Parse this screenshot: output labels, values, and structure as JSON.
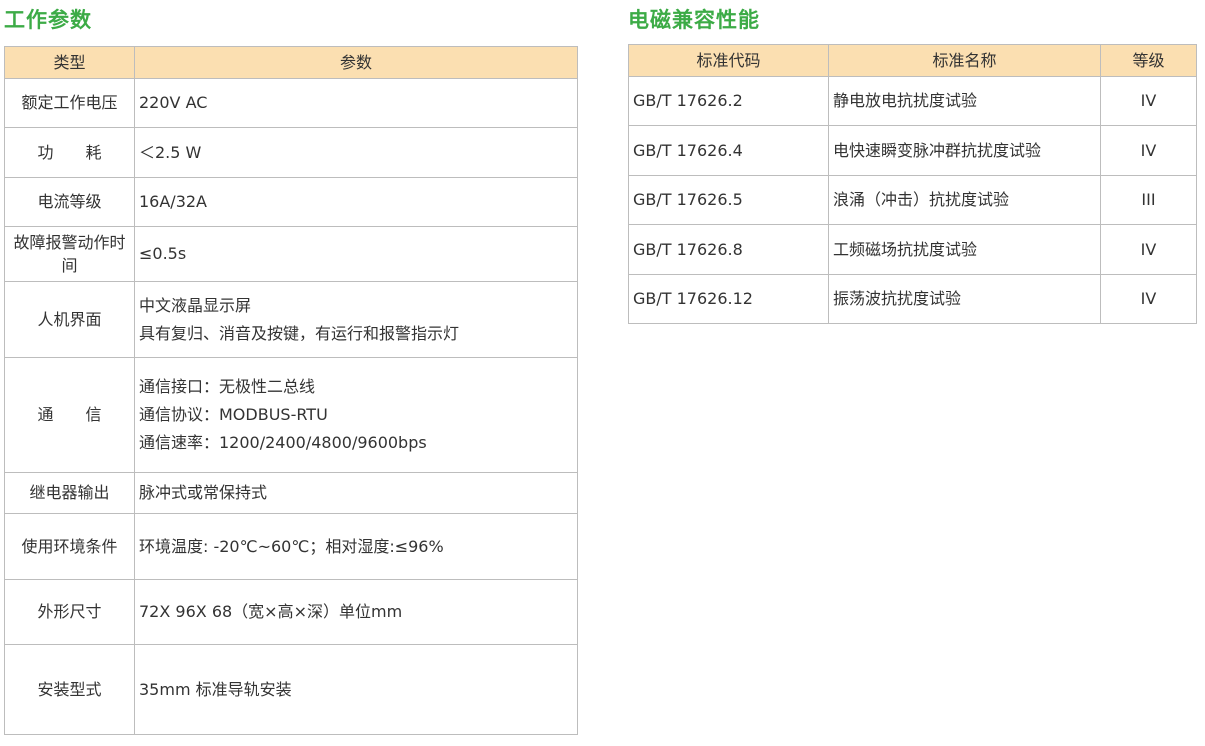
{
  "left": {
    "title": "工作参数",
    "headers": [
      "类型",
      "参数"
    ],
    "rows": [
      {
        "label": "额定工作电压",
        "values": [
          "220V AC"
        ]
      },
      {
        "label": "功　　耗",
        "values": [
          "＜2.5 W"
        ]
      },
      {
        "label": "电流等级",
        "values": [
          "16A/32A"
        ]
      },
      {
        "label": "故障报警动作时间",
        "values": [
          "≤0.5s"
        ]
      },
      {
        "label": "人机界面",
        "values": [
          "中文液晶显示屏",
          "具有复归、消音及按键，有运行和报警指示灯"
        ]
      },
      {
        "label": "通　　信",
        "values": [
          "通信接口：无极性二总线",
          "通信协议：MODBUS-RTU",
          "通信速率：1200/2400/4800/9600bps"
        ]
      },
      {
        "label": "继电器输出",
        "values": [
          "脉冲式或常保持式"
        ]
      },
      {
        "label": "使用环境条件",
        "values": [
          "环境温度: -20℃~60℃；相对湿度:≤96%"
        ]
      },
      {
        "label": "外形尺寸",
        "values": [
          "72X 96X 68（宽×高×深）单位mm"
        ]
      },
      {
        "label": "安装型式",
        "values": [
          "35mm 标准导轨安装"
        ]
      }
    ]
  },
  "right": {
    "title": "电磁兼容性能",
    "headers": [
      "标准代码",
      "标准名称",
      "等级"
    ],
    "rows": [
      {
        "code": "GB/T 17626.2",
        "name": "静电放电抗扰度试验",
        "level": "IV"
      },
      {
        "code": "GB/T 17626.4",
        "name": "电快速瞬变脉冲群抗扰度试验",
        "level": "IV"
      },
      {
        "code": "GB/T 17626.5",
        "name": "浪涌（冲击）抗扰度试验",
        "level": "III"
      },
      {
        "code": "GB/T 17626.8",
        "name": "工频磁场抗扰度试验",
        "level": "IV"
      },
      {
        "code": "GB/T 17626.12",
        "name": "振荡波抗扰度试验",
        "level": "IV"
      }
    ]
  },
  "colors": {
    "title_green": "#3cab46",
    "header_bg": "#fbdfb1",
    "border": "#bdbdbd",
    "text": "#333333"
  }
}
